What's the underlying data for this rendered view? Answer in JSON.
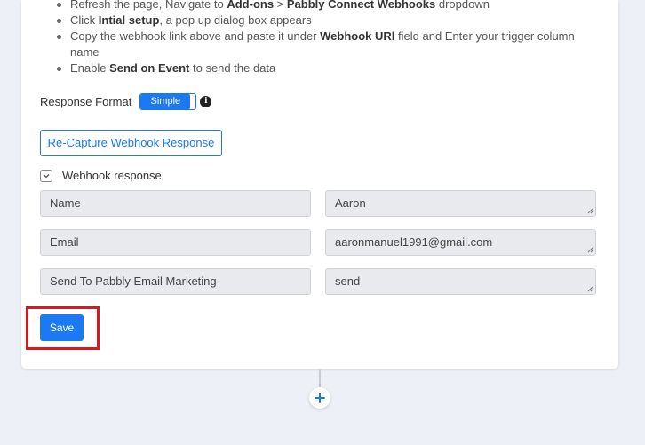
{
  "steps": [
    {
      "pre": "Refresh the page, Navigate to ",
      "b1": "Add-ons",
      "mid": " > ",
      "b2": "Pabbly Connect Webhooks",
      "post": " dropdown"
    },
    {
      "pre": "Click ",
      "b1": "Intial setup",
      "post": ", a pop up dialog box appears"
    },
    {
      "pre": "Copy the webhook link above and paste it under ",
      "b1": "Webhook URl",
      "post": " field and Enter your trigger column name"
    },
    {
      "pre": "Enable ",
      "b1": "Send on Event",
      "post": " to send the data"
    }
  ],
  "response_format": {
    "label": "Response Format",
    "toggle_label": "Simple"
  },
  "recapture_button": "Re-Capture Webhook Response",
  "webhook_response": {
    "label": "Webhook response",
    "rows": [
      {
        "key": "Name",
        "value": "Aaron"
      },
      {
        "key": "Email",
        "value": "aaronmanuel1991@gmail.com"
      },
      {
        "key": "Send To Pabbly Email Marketing",
        "value": "send"
      }
    ]
  },
  "save_button": "Save",
  "colors": {
    "accent": "#1a79f3",
    "highlight": "#e8121c",
    "background": "#eef0f7"
  },
  "icons": {
    "info": "info-icon",
    "chevron": "chevron-down-icon",
    "add": "plus-icon"
  }
}
